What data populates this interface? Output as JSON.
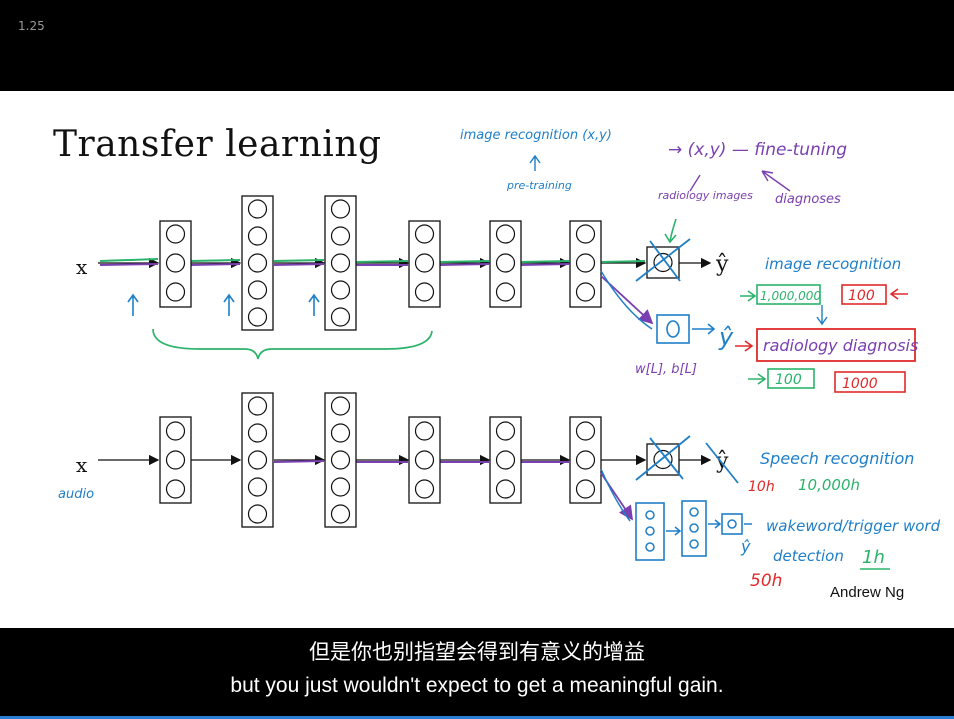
{
  "player": {
    "speed": "1.25"
  },
  "slide": {
    "title": "Transfer learning",
    "author": "Andrew Ng",
    "top_net": {
      "input": "x",
      "output": "ŷ"
    },
    "bottom_net": {
      "input": "x",
      "input_note": "audio",
      "output": "ŷ"
    },
    "annotations": {
      "image_recognition_xy": "image recognition (x,y)",
      "pre_training": "pre-training",
      "xy_fine_tuning": "→ (x,y) — fine-tuning",
      "radiology_images": "radiology images",
      "diagnoses": "diagnoses",
      "weights": "w[L], b[L]",
      "image_recognition": "image recognition",
      "image_count": "1,000,000",
      "image_count_small": "100",
      "radiology_diagnosis": "radiology diagnosis",
      "radiology_count": "100",
      "radiology_count_big": "1000",
      "speech_recognition": "Speech recognition",
      "speech_hours_small": "10h",
      "speech_hours": "10,000h",
      "wakeword": "wakeword/trigger word",
      "detection": "detection",
      "detection_hours": "1h",
      "detection_hours_big": "50h"
    },
    "colors": {
      "green": "#2bb36b",
      "purple": "#7a3fb0",
      "blue": "#1f7fc8",
      "red": "#e02a2a",
      "ink": "#111111"
    }
  },
  "subtitles": {
    "zh": "但是你也别指望会得到有意义的增益",
    "en": "but you just wouldn't expect to get a meaningful gain."
  }
}
